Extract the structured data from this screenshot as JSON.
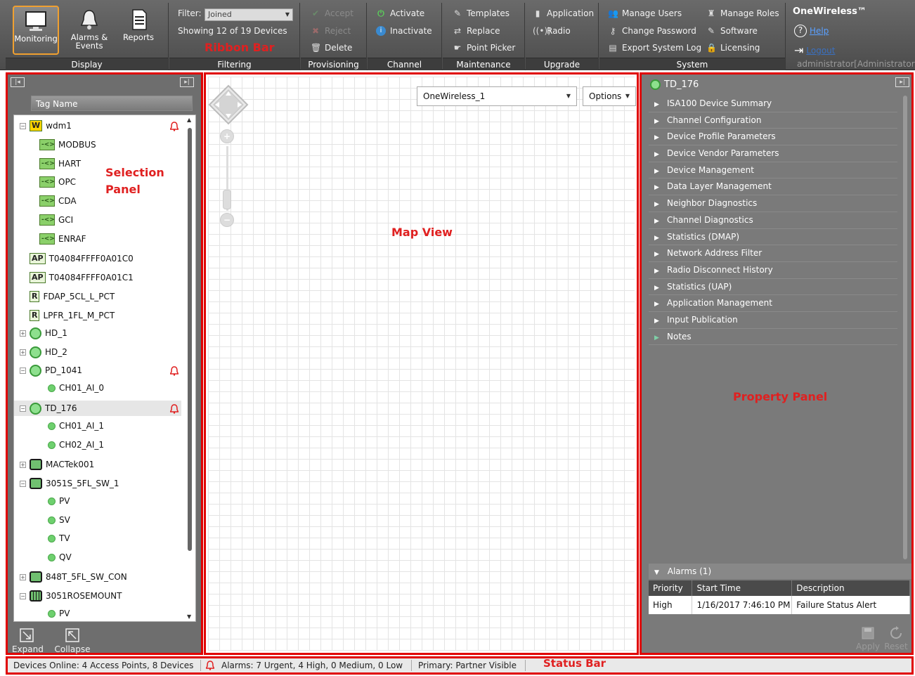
{
  "ribbon": {
    "label": "Ribbon Bar",
    "display": {
      "group_label": "Display",
      "monitoring": "Monitoring",
      "alarms_events_line1": "Alarms &",
      "alarms_events_line2": "Events",
      "reports": "Reports"
    },
    "filtering": {
      "group_label": "Filtering",
      "filter_label": "Filter:",
      "filter_value": "Joined",
      "showing": "Showing 12 of 19 Devices"
    },
    "provisioning": {
      "group_label": "Provisioning",
      "accept": "Accept",
      "reject": "Reject",
      "delete": "Delete"
    },
    "channel": {
      "group_label": "Channel",
      "activate": "Activate",
      "inactivate": "Inactivate"
    },
    "maintenance": {
      "group_label": "Maintenance",
      "templates": "Templates",
      "replace": "Replace",
      "point_picker": "Point Picker"
    },
    "upgrade": {
      "group_label": "Upgrade",
      "application": "Application",
      "radio": "Radio"
    },
    "system": {
      "group_label": "System",
      "manage_users": "Manage Users",
      "manage_roles": "Manage Roles",
      "change_password": "Change Password",
      "software": "Software",
      "export_system_log": "Export System Log",
      "licensing": "Licensing"
    },
    "brand": {
      "title": "OneWireless™",
      "help": "Help",
      "logout": "Logout",
      "user": "administrator[Administrator]"
    }
  },
  "selection_panel": {
    "label_line1": "Selection",
    "label_line2": "Panel",
    "column_header": "Tag Name",
    "tree": [
      {
        "label": "wdm1",
        "badge": "W"
      },
      {
        "label": "MODBUS"
      },
      {
        "label": "HART"
      },
      {
        "label": "OPC"
      },
      {
        "label": "CDA"
      },
      {
        "label": "GCI"
      },
      {
        "label": "ENRAF"
      },
      {
        "label": "T04084FFFF0A01C0",
        "badge": "AP"
      },
      {
        "label": "T04084FFFF0A01C1",
        "badge": "AP"
      },
      {
        "label": "FDAP_5CL_L_PCT",
        "badge": "R"
      },
      {
        "label": "LPFR_1FL_M_PCT",
        "badge": "R"
      },
      {
        "label": "HD_1"
      },
      {
        "label": "HD_2"
      },
      {
        "label": "PD_1041"
      },
      {
        "label": "CH01_AI_0"
      },
      {
        "label": "TD_176"
      },
      {
        "label": "CH01_AI_1"
      },
      {
        "label": "CH02_AI_1"
      },
      {
        "label": "MACTek001"
      },
      {
        "label": "3051S_5FL_SW_1"
      },
      {
        "label": "PV"
      },
      {
        "label": "SV"
      },
      {
        "label": "TV"
      },
      {
        "label": "QV"
      },
      {
        "label": "848T_5FL_SW_CON"
      },
      {
        "label": "3051ROSEMOUNT"
      },
      {
        "label": "PV"
      }
    ],
    "sub_badge": "-<>",
    "expand": "Expand",
    "collapse": "Collapse"
  },
  "map_view": {
    "label": "Map View",
    "network_select": "OneWireless_1",
    "options": "Options"
  },
  "property_panel": {
    "label": "Property Panel",
    "title": "TD_176",
    "items": [
      "ISA100 Device Summary",
      "Channel Configuration",
      "Device Profile Parameters",
      "Device Vendor Parameters",
      "Device Management",
      "Data Layer Management",
      "Neighbor Diagnostics",
      "Channel Diagnostics",
      "Statistics (DMAP)",
      "Network Address Filter",
      "Radio Disconnect History",
      "Statistics (UAP)",
      "Application Management",
      "Input Publication",
      "Notes"
    ],
    "alarms": {
      "title": "Alarms (1)",
      "columns": [
        "Priority",
        "Start Time",
        "Description"
      ],
      "rows": [
        [
          "High",
          "1/16/2017 7:46:10 PM",
          "Failure Status Alert"
        ]
      ]
    },
    "apply": "Apply",
    "reset": "Reset"
  },
  "status_bar": {
    "label": "Status Bar",
    "devices_online": "Devices Online: 4 Access Points, 8 Devices",
    "alarms": "Alarms: 7 Urgent, 4 High, 0 Medium, 0 Low",
    "primary": "Primary: Partner Visible"
  },
  "colors": {
    "annotation_red": "#e00000",
    "ribbon_dark": "#4c4c4c",
    "node_green": "#6ed06e"
  }
}
